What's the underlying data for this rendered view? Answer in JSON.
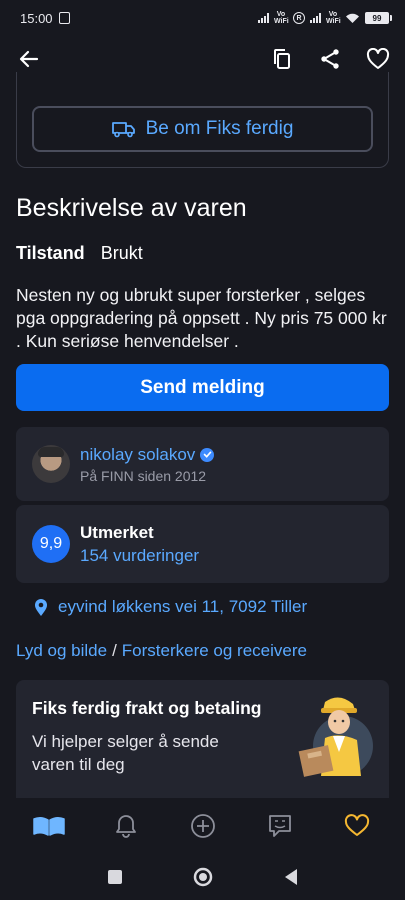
{
  "status_bar": {
    "time": "15:00",
    "vowifi": "Vo WiFi",
    "r_indicator": "R",
    "battery": "99"
  },
  "top_bar": {
    "back_icon": "arrow-left-icon",
    "copy_icon": "copy-icon",
    "share_icon": "share-icon",
    "favorite_icon": "heart-icon"
  },
  "fiks_button": {
    "label": "Be om Fiks ferdig",
    "icon": "truck-icon"
  },
  "description_section": {
    "title": "Beskrivelse av varen",
    "condition_label": "Tilstand",
    "condition_value": "Brukt",
    "text": "Nesten ny og ubrukt super forsterker , selges pga oppgradering på oppsett . Ny pris 75 000 kr . Kun seriøse henvendelser ."
  },
  "send_button": {
    "label": "Send melding"
  },
  "seller": {
    "name": "nikolay solakov",
    "since": "På FINN siden 2012"
  },
  "rating": {
    "score": "9,9",
    "label": "Utmerket",
    "count": "154 vurderinger"
  },
  "address": {
    "text": "eyvind løkkens vei 11, 7092 Tiller"
  },
  "breadcrumb": {
    "items": [
      "Lyd og bilde",
      "Forsterkere og receivere"
    ],
    "separator": "/"
  },
  "promo": {
    "title": "Fiks ferdig frakt og betaling",
    "text": "Vi hjelper selger å sende varen til deg"
  },
  "bottom_nav": {
    "items": [
      "home-icon",
      "bell-icon",
      "plus-circle-icon",
      "chat-icon",
      "heart-icon"
    ]
  },
  "colors": {
    "background": "#17181f",
    "card": "#23252f",
    "primary": "#0a6cf0",
    "link": "#5aa9ff",
    "favorite_active": "#f5b731"
  }
}
